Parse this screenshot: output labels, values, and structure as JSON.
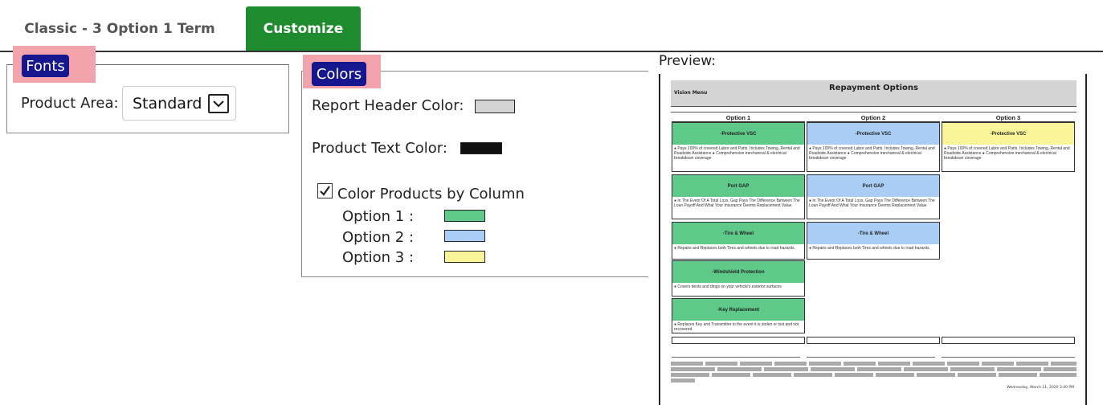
{
  "tabs": [
    {
      "label": "Classic - 3 Option 1 Term"
    },
    {
      "label": "Customize"
    }
  ],
  "fonts": {
    "legend": "Fonts",
    "product_area_label": "Product Area:",
    "product_area_value": "Standard"
  },
  "colors": {
    "legend": "Colors",
    "report_header_label": "Report Header Color:",
    "report_header_color": "#d4d4d4",
    "product_text_label": "Product Text Color:",
    "product_text_color": "#111111",
    "color_by_column_label": "Color Products by Column",
    "color_by_column_checked": true,
    "options": [
      {
        "label": "Option 1 :",
        "color": "#5fc98a"
      },
      {
        "label": "Option 2 :",
        "color": "#a9cdf5"
      },
      {
        "label": "Option 3 :",
        "color": "#fbf59a"
      }
    ]
  },
  "preview": {
    "label": "Preview:",
    "menu_label": "Vision Menu",
    "title": "Repayment Options",
    "columns": [
      "Option 1",
      "Option 2",
      "Option 3"
    ],
    "cards": {
      "vsc_title": "-Protective VSC",
      "vsc_body": "● Pays 100% of covered Labor and Parts. Includes Towing, Rental and Roadside Assistance ● Comprehensive mechanical & electrical breakdown coverage",
      "gap_title": "Port GAP",
      "gap_body": "● In The Event Of A Total Loss, Gap Pays The Difference Between The Loan Payoff And What Your Insurance Deems Replacement Value",
      "tire_title": "-Tire & Wheel",
      "tire_body": "● Repairs and Replaces both Tires and wheels due to road hazards.",
      "windshield_title": "-Windshield Protection",
      "windshield_body": "● Covers dents and dings on your vehicle's exterior surfaces",
      "key_title": "-Key Replacement",
      "key_body": "● Replaces Key and Transmitter in the event it is stolen or lost and not recovered."
    },
    "footer_date": "Wednesday, March 11, 2020 3:40 PM"
  }
}
